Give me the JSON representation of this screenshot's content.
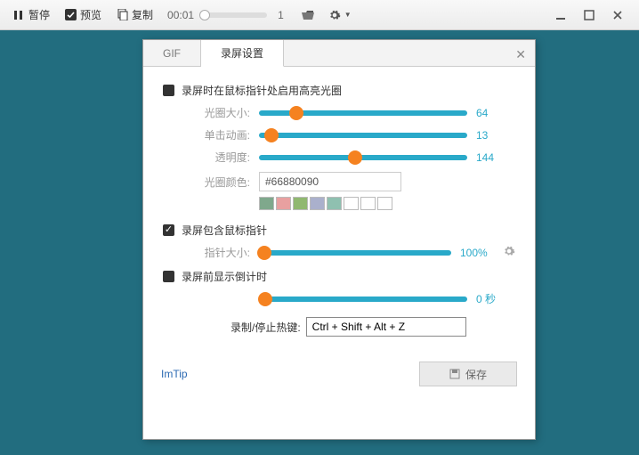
{
  "toolbar": {
    "pause": "暂停",
    "preview": "预览",
    "copy": "复制",
    "time": "00:01",
    "frame": "1"
  },
  "tabs": {
    "gif": "GIF",
    "settings": "录屏设置"
  },
  "section1": {
    "title": "录屏时在鼠标指针处启用高亮光圈",
    "aperture_label": "光圈大小:",
    "aperture_value": "64",
    "click_label": "单击动画:",
    "click_value": "13",
    "opacity_label": "透明度:",
    "opacity_value": "144",
    "color_label": "光圈颜色:",
    "color_value": "#66880090"
  },
  "swatches": [
    "#7fa88c",
    "#e8a0a0",
    "#90b870",
    "#aab0cc",
    "#8fc0b0",
    "#ffffff",
    "#ffffff",
    "#ffffff"
  ],
  "section2": {
    "title": "录屏包含鼠标指针",
    "pointer_label": "指针大小:",
    "pointer_value": "100%"
  },
  "section3": {
    "title": "录屏前显示倒计时",
    "countdown_value": "0 秒"
  },
  "hotkey": {
    "label": "录制/停止热键:",
    "value": "Ctrl + Shift + Alt + Z"
  },
  "footer": {
    "link": "ImTip",
    "save": "保存"
  }
}
